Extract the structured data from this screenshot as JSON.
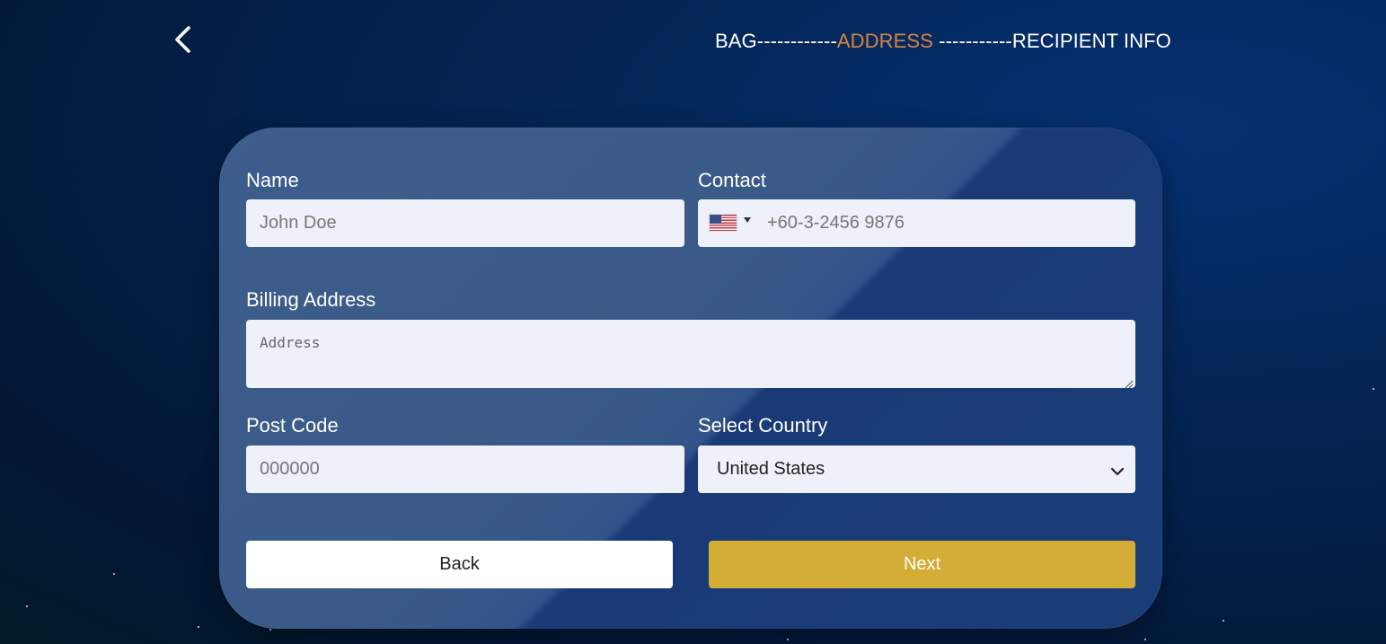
{
  "header": {
    "back_icon": "chevron-left-icon",
    "steps": [
      {
        "label": "BAG",
        "active": false
      },
      {
        "label": "------------",
        "active": false
      },
      {
        "label": "ADDRESS",
        "active": true
      },
      {
        "label": " -----------",
        "active": false
      },
      {
        "label": "RECIPIENT INFO",
        "active": false
      }
    ],
    "active_color": "#d8843f"
  },
  "form": {
    "name": {
      "label": "Name",
      "placeholder": "John Doe",
      "value": ""
    },
    "contact": {
      "label": "Contact",
      "country_flag": "us-flag-icon",
      "placeholder": "+60-3-2456 9876",
      "value": ""
    },
    "billing_address": {
      "label": "Billing Address",
      "placeholder": "Address",
      "value": ""
    },
    "post_code": {
      "label": "Post Code",
      "placeholder": "000000",
      "value": ""
    },
    "country": {
      "label": "Select Country",
      "selected": "United States"
    }
  },
  "actions": {
    "back_label": "Back",
    "next_label": "Next",
    "next_color": "#d4ad36"
  }
}
